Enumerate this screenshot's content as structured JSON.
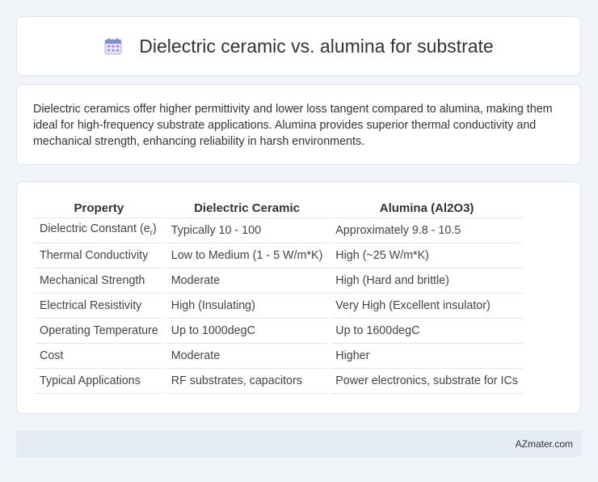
{
  "header": {
    "title": "Dielectric ceramic vs. alumina for substrate",
    "icon": "calendar-icon"
  },
  "summary": {
    "text": "Dielectric ceramics offer higher permittivity and lower loss tangent compared to alumina, making them ideal for high-frequency substrate applications. Alumina provides superior thermal conductivity and mechanical strength, enhancing reliability in harsh environments."
  },
  "table": {
    "headers": [
      "Property",
      "Dielectric Ceramic",
      "Alumina (Al2O3)"
    ],
    "rows": [
      {
        "property": "Dielectric Constant (e",
        "property_sub": "r",
        "property_tail": ")",
        "dielectric": "Typically 10 - 100",
        "alumina": "Approximately 9.8 - 10.5"
      },
      {
        "property": "Thermal Conductivity",
        "dielectric": "Low to Medium (1 - 5 W/m*K)",
        "alumina": "High (~25 W/m*K)"
      },
      {
        "property": "Mechanical Strength",
        "dielectric": "Moderate",
        "alumina": "High (Hard and brittle)"
      },
      {
        "property": "Electrical Resistivity",
        "dielectric": "High (Insulating)",
        "alumina": "Very High (Excellent insulator)"
      },
      {
        "property": "Operating Temperature",
        "dielectric": "Up to 1000degC",
        "alumina": "Up to 1600degC"
      },
      {
        "property": "Cost",
        "dielectric": "Moderate",
        "alumina": "Higher"
      },
      {
        "property": "Typical Applications",
        "dielectric": "RF substrates, capacitors",
        "alumina": "Power electronics, substrate for ICs"
      }
    ]
  },
  "footer": {
    "brand": "AZmater.com"
  }
}
